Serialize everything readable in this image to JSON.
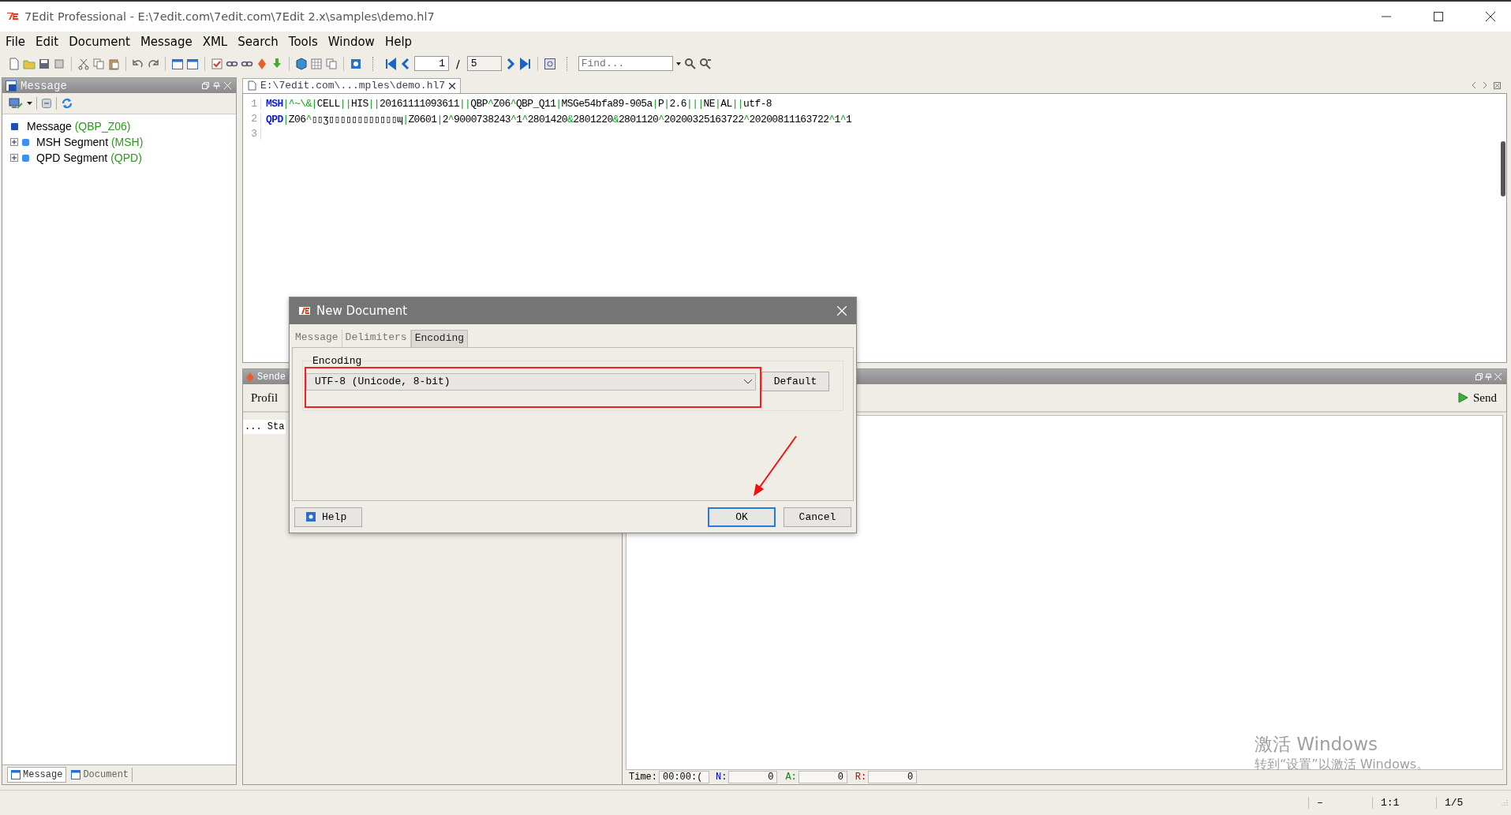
{
  "window": {
    "title": "7Edit Professional - E:\\7edit.com\\7edit.com\\7Edit 2.x\\samples\\demo.hl7"
  },
  "menu": [
    "File",
    "Edit",
    "Document",
    "Message",
    "XML",
    "Search",
    "Tools",
    "Window",
    "Help"
  ],
  "toolbar": {
    "page": "1",
    "separator": "/",
    "total": "5",
    "find_placeholder": "Find..."
  },
  "left_panel": {
    "title": "Message",
    "tree": [
      {
        "label": "Message",
        "code": "(QBP_Z06)",
        "children": [
          {
            "label": "MSH Segment",
            "code": "(MSH)",
            "expanded": false
          },
          {
            "label": "QPD Segment",
            "code": "(QPD)",
            "expanded": false
          }
        ]
      }
    ],
    "tabs": [
      {
        "label": "Message",
        "selected": true
      },
      {
        "label": "Document",
        "selected": false
      }
    ]
  },
  "editor": {
    "tab": "E:\\7edit.com\\...mples\\demo.hl7",
    "lines": [
      {
        "number": "1",
        "segment": "MSH",
        "text": "|^~\\&|CELL||HIS||20161111093611||QBP^Z06^QBP_Q11|MSGe54bfa89-905a|P|2.6|||NE|AL||utf-8"
      },
      {
        "number": "2",
        "segment": "QPD",
        "text": "|Z06^▯▯ʒ▯▯▯▯▯▯▯▯▯▯▯▯ɰ|Z0601|2^9000738243^1^2801420&2801220&2801120^20200325163722^20200811163722^1^1"
      },
      {
        "number": "3"
      }
    ]
  },
  "sender": {
    "title": "Sende",
    "profile": "Profil",
    "send": "Send",
    "log": "... Sta",
    "counters": [
      {
        "label": "Time:",
        "value": "00:00:(",
        "color": "#000000"
      },
      {
        "label": "N:",
        "value": "0",
        "color": "#0000cc"
      },
      {
        "label": "A:",
        "value": "0",
        "color": "#008800"
      },
      {
        "label": "R:",
        "value": "0",
        "color": "#cc0000"
      }
    ]
  },
  "status_bar": [
    "–",
    "1:1",
    "1/5"
  ],
  "activation": {
    "title": "激活 Windows",
    "text": "转到“设置”以激活 Windows。"
  },
  "dialog": {
    "title": "New Document",
    "tabs": [
      {
        "label": "Message",
        "selected": false
      },
      {
        "label": "Delimiters",
        "selected": false
      },
      {
        "label": "Encoding",
        "selected": true
      }
    ],
    "group": "Encoding",
    "encoding": "UTF-8 (Unicode, 8-bit)",
    "default_button": "Default",
    "buttons": {
      "help": "Help",
      "ok": "OK",
      "cancel": "Cancel"
    }
  }
}
